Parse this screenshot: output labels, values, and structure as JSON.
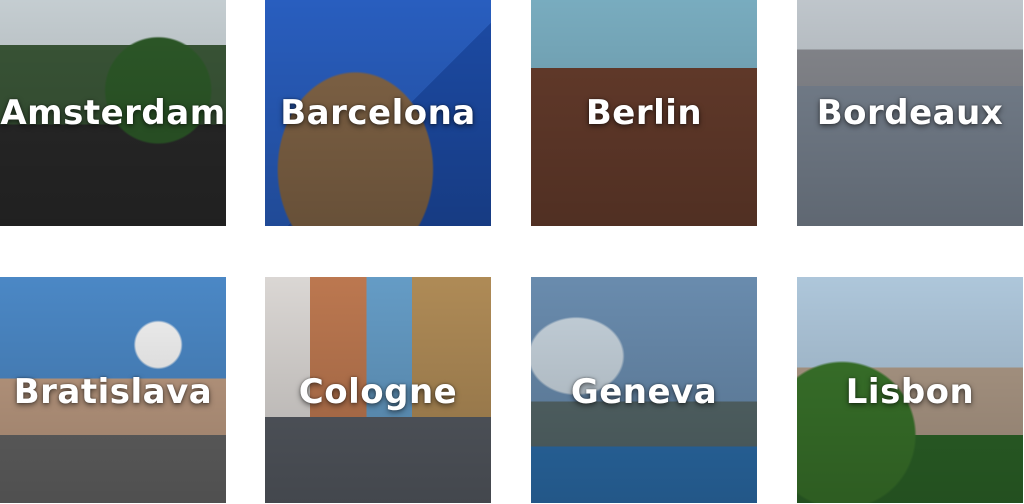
{
  "cities": [
    {
      "name": "Amsterdam"
    },
    {
      "name": "Barcelona"
    },
    {
      "name": "Berlin"
    },
    {
      "name": "Bordeaux"
    },
    {
      "name": "Bratislava"
    },
    {
      "name": "Cologne"
    },
    {
      "name": "Geneva"
    },
    {
      "name": "Lisbon"
    }
  ]
}
